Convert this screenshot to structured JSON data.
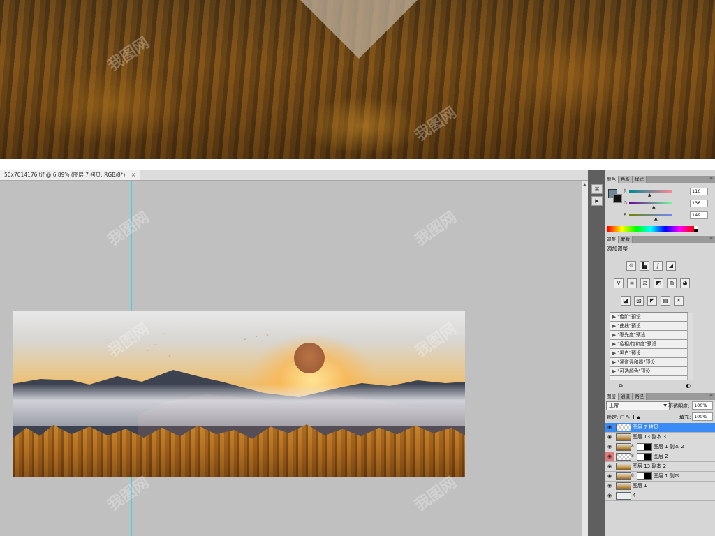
{
  "document": {
    "tab_title": "50x7014176.tif @ 6.89% (图层 7 拷贝, RGB/8*)",
    "close_symbol": "×"
  },
  "dock": {
    "tool1": "⌘",
    "tool2": "▶"
  },
  "color_panel": {
    "tabs": [
      "颜色",
      "色板",
      "样式"
    ],
    "channels": [
      {
        "label": "R",
        "value": "110"
      },
      {
        "label": "G",
        "value": "136"
      },
      {
        "label": "B",
        "value": "149"
      }
    ],
    "foreground_color": "#6e8895",
    "background_color": "#111111"
  },
  "adjustments_panel": {
    "tabs": [
      "调整",
      "蒙版"
    ],
    "title": "添加调整",
    "presets": [
      "\"色阶\"预设",
      "\"曲线\"预设",
      "\"曝光度\"预设",
      "\"色相/饱和度\"预设",
      "\"黑白\"预设",
      "\"通道混和器\"预设",
      "\"可选颜色\"预设"
    ]
  },
  "layers_panel": {
    "tabs": [
      "图层",
      "通道",
      "路径"
    ],
    "blend_mode": "正常",
    "opacity_label": "不透明度:",
    "opacity_value": "100%",
    "lock_label": "锁定:",
    "fill_label": "填充:",
    "fill_value": "100%",
    "layers": [
      {
        "name": "图层 7 拷贝",
        "selected": true
      },
      {
        "name": "图层 13 副本 3"
      },
      {
        "name": "图层 1 副本 2"
      },
      {
        "name": "图层 2"
      },
      {
        "name": "图层 13 副本 2"
      },
      {
        "name": "图层 1 副本"
      },
      {
        "name": "图层 1"
      },
      {
        "name": "4"
      }
    ]
  },
  "watermark_text": "我图网"
}
